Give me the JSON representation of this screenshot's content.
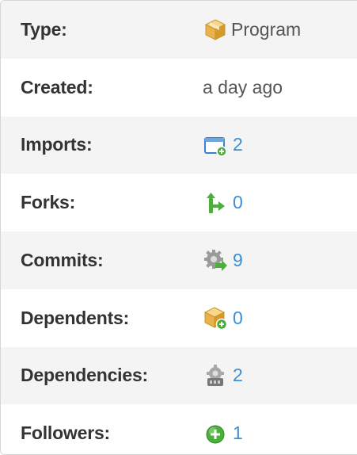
{
  "rows": [
    {
      "label": "Type:",
      "value": "Program",
      "icon": "package-icon"
    },
    {
      "label": "Created:",
      "value": "a day ago"
    },
    {
      "label": "Imports:",
      "value": "2",
      "icon": "import-window-icon"
    },
    {
      "label": "Forks:",
      "value": "0",
      "icon": "fork-icon"
    },
    {
      "label": "Commits:",
      "value": "9",
      "icon": "commit-gear-icon"
    },
    {
      "label": "Dependents:",
      "value": "0",
      "icon": "package-add-icon"
    },
    {
      "label": "Dependencies:",
      "value": "2",
      "icon": "dependency-gear-icon"
    },
    {
      "label": "Followers:",
      "value": "1",
      "icon": "follow-plus-icon"
    }
  ],
  "colors": {
    "link": "#3a8fd8",
    "label": "#333333",
    "stripe": "#f4f4f4",
    "green": "#4caf3c",
    "package": "#f0c060"
  }
}
